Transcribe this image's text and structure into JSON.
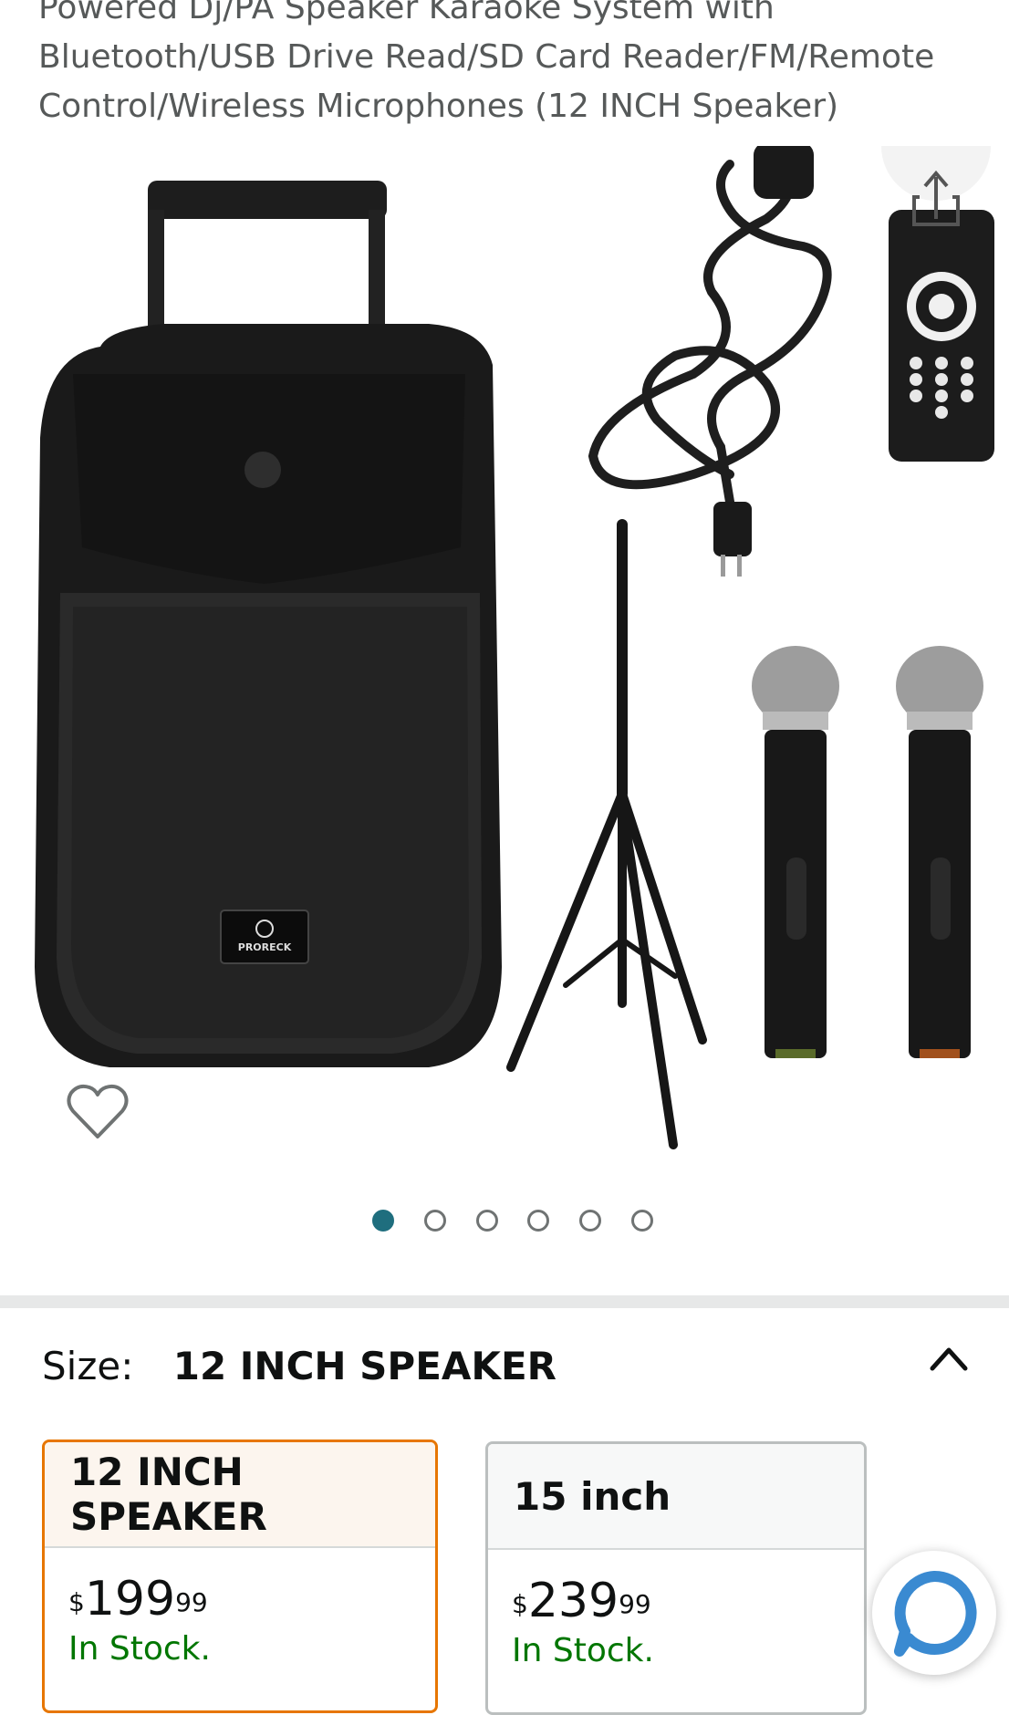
{
  "product": {
    "title": "Powered Dj/PA Speaker Karaoke System with Bluetooth/USB Drive Read/SD Card Reader/FM/Remote Control/Wireless Microphones (12 INCH Speaker)"
  },
  "gallery": {
    "image_count": 6,
    "active_index": 0,
    "remote_keys": [
      "1",
      "2",
      "3",
      "4",
      "5",
      "6",
      "7",
      "8",
      "9",
      "0"
    ],
    "speaker_brand": "PRORECK"
  },
  "size_selector": {
    "label": "Size:",
    "selected": "12 INCH SPEAKER",
    "options": [
      {
        "name": "12 INCH SPEAKER",
        "currency": "$",
        "whole": "199",
        "cents": "99",
        "availability": "In Stock."
      },
      {
        "name": "15 inch",
        "currency": "$",
        "whole": "239",
        "cents": "99",
        "availability": "In Stock."
      }
    ]
  },
  "colors": {
    "selected_border": "#e77600",
    "in_stock": "#007600",
    "active_dot": "#1f6e7e",
    "chat_ring": "#3a8ad1"
  },
  "icons": [
    "share-icon",
    "heart-icon",
    "chevron-up-icon",
    "chat-icon"
  ]
}
